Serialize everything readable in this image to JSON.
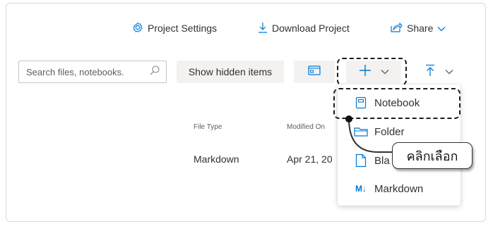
{
  "toolbar": {
    "project_settings": "Project Settings",
    "download_project": "Download Project",
    "share": "Share"
  },
  "actions": {
    "search_placeholder": "Search files, notebooks.",
    "show_hidden": "Show hidden items"
  },
  "table": {
    "headers": [
      "File Type",
      "Modified On"
    ],
    "rows": [
      {
        "file_type": "Markdown",
        "modified_on": "Apr 21, 20"
      }
    ]
  },
  "new_menu": {
    "items": [
      {
        "label": "Notebook",
        "icon": "notebook-icon"
      },
      {
        "label": "Folder",
        "icon": "folder-icon"
      },
      {
        "label": "Bla",
        "icon": "blank-file-icon"
      },
      {
        "label": "Markdown",
        "icon": "markdown-icon"
      }
    ]
  },
  "annotation": {
    "callout": "คลิกเลือก"
  },
  "colors": {
    "accent": "#0078d4",
    "border": "#d9d9d9",
    "text": "#323130",
    "dashed_highlight": "#1b1b1b"
  }
}
